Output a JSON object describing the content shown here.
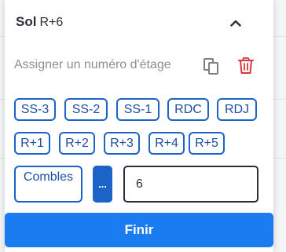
{
  "header": {
    "title": "Sol",
    "subtitle": "R+6",
    "collapse_icon": "chevron-up-icon"
  },
  "assign": {
    "label": "Assigner un numéro d'étage",
    "copy_icon": "copy-icon",
    "delete_icon": "trash-icon"
  },
  "floors": {
    "row1": [
      "SS-3",
      "SS-2",
      "SS-1",
      "RDC",
      "RDJ"
    ],
    "row2": [
      "R+1",
      "R+2",
      "R+3",
      "R+4",
      "R+5"
    ],
    "attic": "Combles",
    "more_label": "...",
    "custom_value": "6"
  },
  "footer": {
    "finish_label": "Finir"
  },
  "colors": {
    "accent": "#1b63c6",
    "primary_button": "#1a7cf0",
    "delete": "#d9363e"
  }
}
